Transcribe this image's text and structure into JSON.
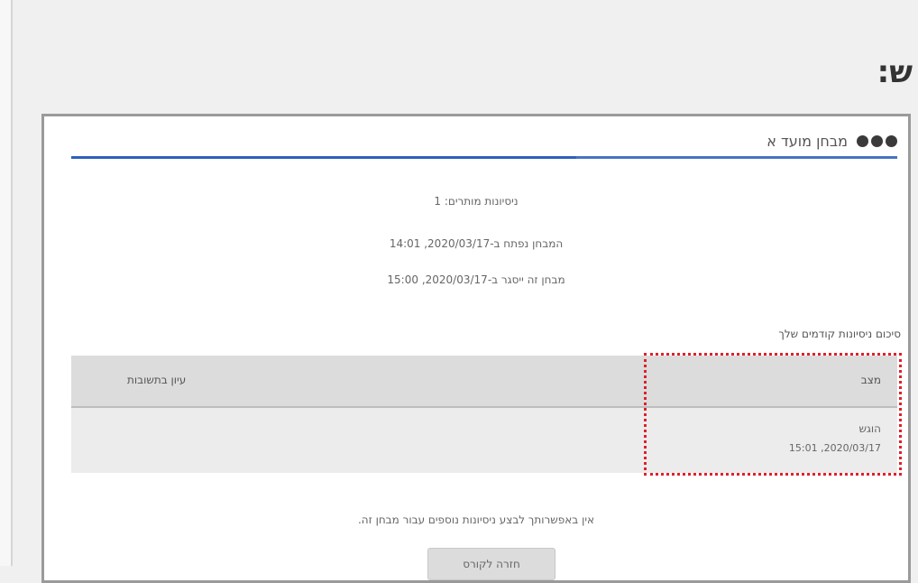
{
  "page": {
    "title": "ש:"
  },
  "quiz": {
    "title": "מבחן מועד א",
    "attempts_allowed": "ניסיונות מותרים: 1",
    "opened": "המבחן נפתח ב-2020/03/17, 14:01",
    "closed": "מבחן זה ייסגר ב-2020/03/17, 15:00"
  },
  "summary": {
    "title": "סיכום ניסיונות קודמים שלך",
    "columns": {
      "status": "מצב",
      "review": "עיון בתשובות"
    },
    "rows": [
      {
        "status": "הוגש",
        "date": "2020/03/17, 15:01"
      }
    ]
  },
  "footer": {
    "note": "אין באפשרותך לבצע ניסיונות נוספים עבור מבחן זה.",
    "back_button": "חזרה לקורס"
  },
  "colors": {
    "accent": "#2f5fbd",
    "highlight": "#e0202a"
  }
}
